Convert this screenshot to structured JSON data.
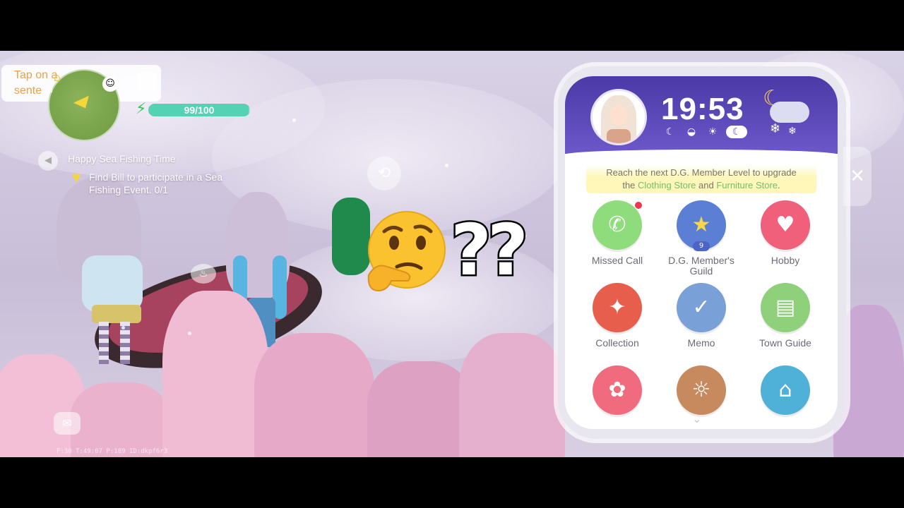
{
  "hud": {
    "tip_text": "Tap on a sente",
    "energy_text": "99/100",
    "energy_level": 0.99,
    "map_compass": "N"
  },
  "quest": {
    "title": "Happy Sea Fishing Time",
    "description": "Find Bill to participate in a Sea Fishing Event.  0/1"
  },
  "overlay": {
    "question_marks": "??"
  },
  "debug": {
    "text": "F:30   T:49:07   P:189   ID:dkpf6r3"
  },
  "phone": {
    "time": "19:53",
    "day_phases": [
      "night-moon-icon",
      "sunrise-icon",
      "sun-icon",
      "moon-icon"
    ],
    "active_phase": 3,
    "notice": {
      "line1": "Reach the next D.G. Member Level to upgrade",
      "pre": "the ",
      "store1": "Clothing Store",
      "mid": " and ",
      "store2": "Furniture Store",
      "post": "."
    },
    "apps": [
      {
        "label": "Missed Call",
        "icon": "phone-call-icon",
        "color": "#8fdc7c",
        "has_dot": true
      },
      {
        "label": "D.G. Member's Guild",
        "icon": "star-badge-icon",
        "color": "#5c7fd6",
        "badge": "9"
      },
      {
        "label": "Hobby",
        "icon": "heart-icon",
        "color": "#f0607a"
      },
      {
        "label": "Collection",
        "icon": "book-icon",
        "color": "#e85e4d"
      },
      {
        "label": "Memo",
        "icon": "clipboard-icon",
        "color": "#7aa0d8"
      },
      {
        "label": "Town Guide",
        "icon": "map-icon",
        "color": "#8fd07a"
      },
      {
        "label": "",
        "icon": "paw-icon",
        "color": "#f06b7e"
      },
      {
        "label": "",
        "icon": "lightbulb-icon",
        "color": "#c7895e"
      },
      {
        "label": "",
        "icon": "blueprint-icon",
        "color": "#4fb0d8"
      }
    ],
    "colors": {
      "header": "#5a46b6",
      "highlight": "#6fbf6b"
    }
  }
}
